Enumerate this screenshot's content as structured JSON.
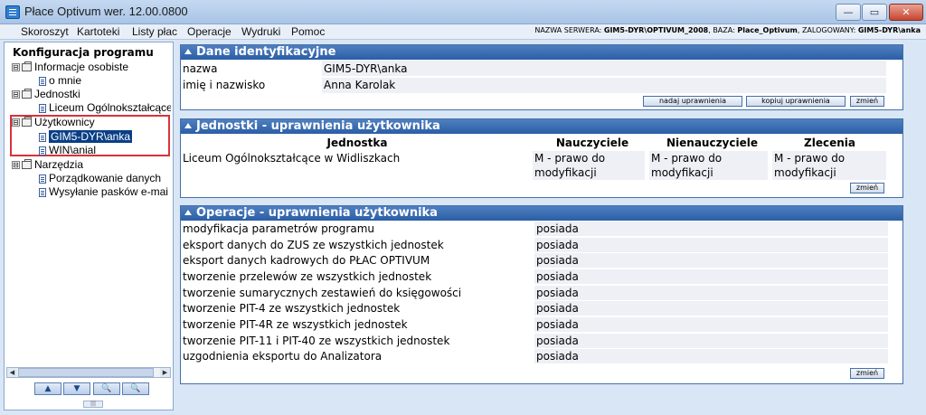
{
  "window": {
    "title": "Płace Optivum wer. 12.00.0800",
    "min_glyph": "—",
    "max_glyph": "▭",
    "close_glyph": "✕"
  },
  "menu": {
    "items": [
      "Skoroszyt",
      "Kartoteki",
      "Listy płac",
      "Operacje",
      "Wydruki",
      "Pomoc"
    ],
    "server_label": "NAZWA SERWERA: ",
    "server_value": "GIM5-DYR\\OPTIVUM_2008",
    "db_label": ", BAZA: ",
    "db_value": "Place_Optivum",
    "user_label": ", ZALOGOWANY: ",
    "user_value": "GIM5-DYR\\anka"
  },
  "sidebar": {
    "title": "Konfiguracja programu",
    "tree": [
      {
        "label": "Informacje osobiste",
        "level": 0
      },
      {
        "label": "o mnie",
        "level": 1
      },
      {
        "label": "Jednostki",
        "level": 0
      },
      {
        "label": "Liceum Ogólnokształcące",
        "level": 1
      },
      {
        "label": "Użytkownicy",
        "level": 0
      },
      {
        "label": "GIM5-DYR\\anka",
        "level": 1,
        "selected": true
      },
      {
        "label": "WIN\\anial",
        "level": 1
      },
      {
        "label": "Narzędzia",
        "level": 0
      },
      {
        "label": "Porządkowanie danych",
        "level": 1
      },
      {
        "label": "Wysyłanie pasków e-mai",
        "level": 1
      }
    ],
    "expander_glyph": "⊟"
  },
  "identity": {
    "header": "Dane identyfikacyjne",
    "name_label": "nazwa",
    "name_value": "GIM5-DYR\\anka",
    "fullname_label": "imię i nazwisko",
    "fullname_value": "Anna Karolak",
    "btn_grant": "nadaj uprawnienia",
    "btn_copy": "kopiuj uprawnienia",
    "btn_change": "zmień"
  },
  "units": {
    "header": "Jednostki - uprawnienia użytkownika",
    "columns": [
      "Jednostka",
      "Nauczyciele",
      "Nienauczyciele",
      "Zlecenia"
    ],
    "rows": [
      {
        "unit": "Liceum Ogólnokształcące w Widliszkach",
        "teachers": "M - prawo do modyfikacji",
        "nonteachers": "M - prawo do modyfikacji",
        "contracts": "M - prawo do modyfikacji"
      }
    ],
    "btn_change": "zmień"
  },
  "operations": {
    "header": "Operacje - uprawnienia użytkownika",
    "rows": [
      {
        "label": "modyfikacja parametrów programu",
        "value": "posiada"
      },
      {
        "label": "eksport danych do ZUS ze wszystkich jednostek",
        "value": "posiada"
      },
      {
        "label": "eksport danych kadrowych do PŁAC OPTIVUM",
        "value": "posiada"
      },
      {
        "label": "tworzenie przelewów ze wszystkich jednostek",
        "value": "posiada"
      },
      {
        "label": "tworzenie sumarycznych zestawień do księgowości",
        "value": "posiada"
      },
      {
        "label": "tworzenie PIT-4 ze wszystkich jednostek",
        "value": "posiada"
      },
      {
        "label": "tworzenie PIT-4R ze wszystkich jednostek",
        "value": "posiada"
      },
      {
        "label": "tworzenie PIT-11 i PIT-40 ze wszystkich jednostek",
        "value": "posiada"
      },
      {
        "label": "uzgodnienia eksportu do Analizatora",
        "value": "posiada"
      }
    ],
    "btn_change": "zmień"
  },
  "colors": {
    "panel_header": "#2a5ea6",
    "selection": "#0a3f86",
    "highlight_border": "#d6333a"
  }
}
